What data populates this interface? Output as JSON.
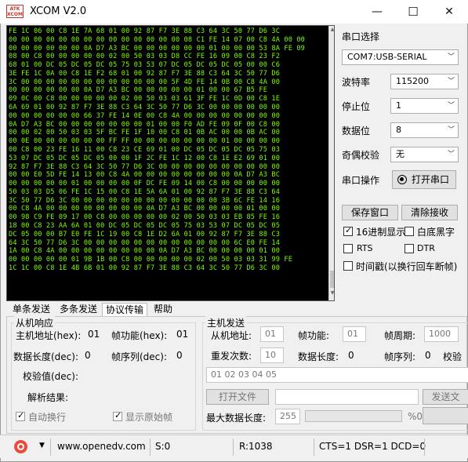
{
  "window": {
    "title": "XCOM V2.0",
    "icon_text": "ATK XCOM",
    "minimize": "—",
    "maximize": "☐",
    "close": "✕"
  },
  "receive": {
    "hex_text": "FE 1C 06 00 C8 1E 7A 68 01 00 92 87 F7 3E 88 C3 64 3C 50 77 D6 3C\n00 00 00 00 00 00 00 00 00 00 00 00 00 00 08 C1 FE 14 07 00 C8 4A 00 00\n00 00 00 00 00 00 0A D7 A3 BC 00 00 00 00 00 00 01 00 00 00 53 8A FE 09\n08 00 C8 00 00 00 00 00 02 00 50 03 03 D8 CC FE 16 09 00 C8 23 F2\n68 01 00 DC 05 DC 05 DC 05 75 03 53 07 DC 05 DC 05 DC 05 00 00 C6\n3E FE 1C 0A 00 C8 1E F2 68 01 00 92 87 F7 3E 88 C3 64 3C 50 77 D6\n3C 00 00 00 00 00 00 00 00 00 00 00 00 5F 4D FE 14 0B 00 C8 4A 00\n00 00 00 00 00 00 0A D7 A3 BC 00 00 00 00 00 01 00 00 67 B5 FE\n09 0C 00 C8 00 00 00 00 00 02 00 50 03 03 61 3F FE 1C 0D 00 C8 1E\n6A 69 01 00 92 87 F7 3E 88 C3 64 3C 50 77 D6 3C 00 00 00 00 00 00\n00 00 00 00 00 00 66 37 FE 14 0E 00 C8 4A 00 00 00 00 00 00 00 00\n0A D7 A3 BC 00 00 00 00 00 00 00 01 00 00 F0 AD FE 09 0F 00 C8 00\n00 00 02 00 50 03 03 5F BC FE 1F 10 00 C8 01 0B AC 00 00 0B AC 00\n00 0E 00 00 00 00 00 00 FF FF 00 00 00 00 00 00 00 01 00 00 00 00\n00 C8 00 23 FE 16 11 00 C8 23 CE 69 01 00 DC 05 DC 05 DC 05 75 03\n53 07 DC 05 DC 05 DC 05 00 00 1F 2C FE 1C 12 00 C8 1E E2 69 01 00\n92 87 F7 3E 88 C3 64 3C 50 77 D6 3C 00 00 00 00 00 00 00 00 00 00\n00 00 E0 5D FE 14 13 00 C8 4A 00 00 00 00 00 00 00 00 0A D7 A3 BC\n00 00 00 00 00 01 00 00 00 00 0F DC FE 09 14 00 C8 00 00 00 00 00\n50 03 03 D5 06 FE 1C 15 00 C8 1E 5A 6A 01 00 92 87 F7 3E 88 C3 64\n3C 50 77 D6 3C 00 00 00 00 00 00 00 00 00 00 00 00 3B 6C FE 14 16\n00 C8 4A 00 00 00 00 00 00 00 00 0A D7 A3 BC 00 00 00 00 01 00 00\n00 98 C9 FE 09 17 00 C8 00 00 00 00 00 02 00 50 03 03 EB 85 FE 16\n18 00 C8 23 AA 6A 01 00 DC 05 DC 05 DC 05 75 03 53 07 DC 05 DC 05\nDC 05 00 00 B7 E0 FE 1C 19 00 C8 1E D2 6A 01 00 92 87 F7 3E 88 C3\n64 3C 50 77 D6 3C 00 00 00 00 00 00 00 00 00 00 00 00 6C E0 FE 14\n1A 00 C8 4A 00 00 00 00 00 00 00 00 0A D7 A3 BC 00 00 00 00 01 00\n00 00 00 00 00 01 9B 1B 00 C8 00 00 00 00 00 02 00 50 03 03 31 99 FE\n1C 1C 00 C8 1E 4B 6B 01 00 92 87 F7 3E 88 C3 64 3C 50 77 D6 3C 00"
  },
  "settings": {
    "title": "串口选择",
    "port_value": "COM7:USB-SERIAL",
    "baud_label": "波特率",
    "baud_value": "115200",
    "stop_label": "停止位",
    "stop_value": "1",
    "data_label": "数据位",
    "data_value": "8",
    "parity_label": "奇偶校验",
    "parity_value": "无",
    "op_label": "串口操作",
    "open_button": "打开串口",
    "save_window": "保存窗口",
    "clear_receive": "清除接收",
    "hex_display": "16进制显示",
    "white_black": "白底黑字",
    "rts": "RTS",
    "dtr": "DTR",
    "timestamp": "时间戳(以换行回车断帧)"
  },
  "tabs": [
    "单条发送",
    "多条发送",
    "协议传输",
    "帮助"
  ],
  "slave": {
    "title": "从机响应",
    "addr_label": "主机地址(hex):",
    "addr_value": "01",
    "func_label": "帧功能(hex):",
    "func_value": "01",
    "len_label": "数据长度(dec):",
    "len_value": "0",
    "seq_label": "帧序列(dec):",
    "seq_value": "0",
    "check_label": "校验值(dec):",
    "parse_label": "解析结果:",
    "auto_wrap": "自动换行",
    "show_raw": "显示原始帧"
  },
  "master": {
    "title": "主机发送",
    "addr_label": "从机地址:",
    "addr_value": "01",
    "func_label": "帧功能:",
    "func_value": "01",
    "period_label": "帧周期:",
    "period_value": "1000",
    "repeat_label": "重发次数:",
    "repeat_value": "10",
    "len_label": "数据长度:",
    "len_value": "0",
    "seq_label": "帧序列:",
    "seq_value": "0",
    "check_label": "校验",
    "data_value": "01 02 03 04 05",
    "open_file": "打开文件",
    "send_file": "发送文",
    "max_len_label": "最大数据长度:",
    "max_len_value": "255",
    "percent": "%0"
  },
  "status": {
    "url": "www.openedv.com",
    "sent": "S:0",
    "received": "R:1038",
    "lines": "CTS=1 DSR=1 DCD=0"
  }
}
